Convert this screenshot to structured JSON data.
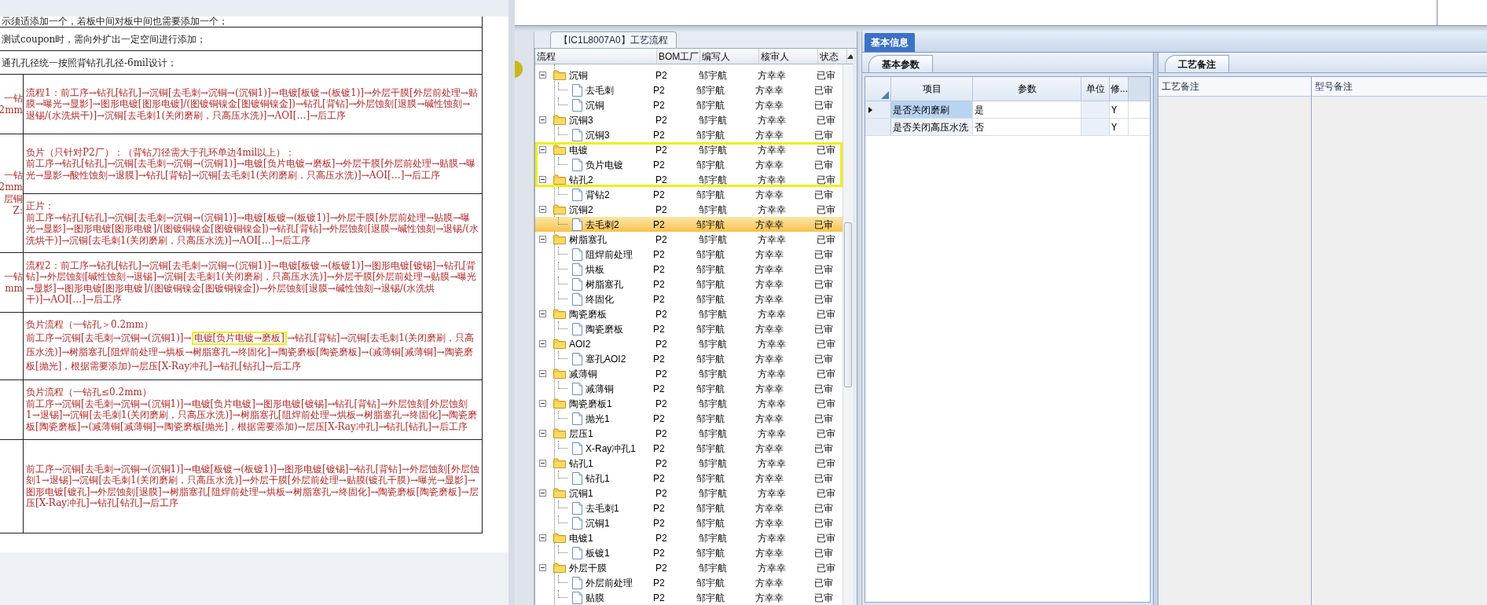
{
  "document": {
    "notes": [
      "示须适添加一个，若板中间对板中间也需要添加一个；",
      "测试coupon时，需向外扩出一定空间进行添加；",
      "通孔孔径统一按照背钻孔孔径-6mil设计；"
    ],
    "rows": [
      {
        "side_label": [
          "一钻",
          "2mm"
        ],
        "cells": [
          [
            "流程1：前工序→钻孔[钻孔]→沉铜[去毛刺→沉铜→(沉铜1)]→电镀[板镀→(板镀1)]→外层干膜[外层前处理→贴膜→曝光→显影]→图形电镀[图形电镀]/(图镀铜镍金[图镀铜镍金])→钻孔[背钻]→外层蚀刻[退膜→碱性蚀刻→退锡/(水洗烘干)]→沉铜[去毛刺1(关闭磨刷，只高压水洗)]→AOI[…]→后工序"
          ]
        ]
      },
      {
        "side_label": [
          "一钻",
          "2mm",
          "层铜",
          "Z:"
        ],
        "cells": [
          [
            "负片（只针对P2厂）：（背钻刀径需大于孔环单边4mil以上）：",
            "前工序→钻孔[钻孔]→沉铜[去毛刺→沉铜→(沉铜1)]→电镀[负片电镀→磨板]→外层干膜[外层前处理→贴膜→曝光→显影→酸性蚀刻→退膜]→钻孔[背钻]→沉铜[去毛刺1(关闭磨刷，只高压水洗)]→AOI[…]→后工序"
          ],
          [
            "正片：",
            "前工序→钻孔[钻孔]→沉铜[去毛刺→沉铜→(沉铜1)]→电镀[板镀→(板镀1)]→外层干膜[外层前处理→贴膜→曝光→显影]→图形电镀[图形电镀]/(图镀铜镍金[图镀铜镍金])→钻孔[背钻]→外层蚀刻[退膜→碱性蚀刻→退锡/(水洗烘干)]→沉铜[去毛刺1(关闭磨刷，只高压水洗)]→AOI[…]→后工序"
          ]
        ]
      },
      {
        "side_label": [
          "一钻",
          "mm"
        ],
        "cells": [
          [
            "流程2：前工序→钻孔[钻孔]→沉铜[去毛刺→沉铜→(沉铜1)]→电镀[板镀→(板镀1)]→图形电镀[镀锡]→钻孔[背钻]→外层蚀刻[碱性蚀刻→退锡]→沉铜[去毛刺1(关闭磨刷，只高压水洗)]→外层干膜[外层前处理→贴膜→曝光→显影]→图形电镀[图形电镀]/(图镀铜镍金[图镀铜镍金])→外层蚀刻[退膜→碱性蚀刻→退锡/(水洗烘干)]→AOI[…]→后工序"
          ]
        ]
      },
      {
        "cells": [
          [
            "负片流程（一钻孔＞0.2mm）",
            {
              "segments": [
                {
                  "text": "前工序→沉铜[去毛刺→沉铜→(沉铜1)]→",
                  "highlighted": false
                },
                {
                  "text": "电镀[负片电镀→磨板]",
                  "highlighted": true
                },
                {
                  "text": "→钻孔[背钻]→沉铜[去毛刺1(关闭磨刷，只高压水洗)]→树脂塞孔[阻焊前处理→烘板→树脂塞孔→终固化]→陶瓷磨板[陶瓷磨板]→(减薄铜[减薄铜]→陶瓷磨板[抛光]，根据需要添加)→层压[X-Ray冲孔]→钻孔[钻孔]→后工序",
                  "highlighted": false
                }
              ]
            }
          ]
        ]
      },
      {
        "cells": [
          [
            "负片流程（一钻孔≤0.2mm）",
            "前工序→沉铜[去毛刺→沉铜→(沉铜1)]→电镀[负片电镀]→图形电镀[镀锡]→钻孔[背钻]→外层蚀刻[外层蚀刻1→退锡]→沉铜[去毛刺1(关闭磨刷，只高压水洗)]→树脂塞孔[阻焊前处理→烘板→树脂塞孔→终固化]→陶瓷磨板[陶瓷磨板]→(减薄铜[减薄铜]→陶瓷磨板[抛光]，根据需要添加)→层压[X-Ray冲孔]→钻孔[钻孔]→后工序"
          ]
        ]
      },
      {
        "cells": [
          [
            "前工序→沉铜[去毛刺→沉铜→(沉铜1)]→电镀[板镀→(板镀1)]→图形电镀[镀锡]→钻孔[背钻]→外层蚀刻[外层蚀刻1→退锡]→沉铜[去毛刺1(关闭磨刷，只高压水洗)]→外层干膜[外层前处理→贴膜(镀孔干膜)→曝光→显影]→图形电镀[镀孔]→外层蚀刻[退膜]→树脂塞孔[阻焊前处理→烘板→树脂塞孔→终固化]→陶瓷磨板[陶瓷磨板]→层压[X-Ray冲孔]→钻孔[钻孔]→后工序"
          ]
        ]
      }
    ]
  },
  "process_panel": {
    "title": "【IC1L8007A0】工艺流程",
    "columns": [
      "流程",
      "BOM工厂",
      "编写人",
      "核审人",
      "状态"
    ],
    "tree": [
      {
        "name": "沉铜",
        "bom_factory": "P2",
        "author": "邹宇航",
        "reviewer": "方幸幸",
        "status": "已审",
        "expanded": true,
        "selected": false,
        "children": [
          {
            "name": "去毛刺",
            "bom_factory": "P2",
            "author": "邹宇航",
            "reviewer": "方幸幸",
            "status": "已审",
            "selected": false
          },
          {
            "name": "沉铜",
            "bom_factory": "P2",
            "author": "邹宇航",
            "reviewer": "方幸幸",
            "status": "已审",
            "selected": false
          }
        ]
      },
      {
        "name": "沉铜3",
        "bom_factory": "P2",
        "author": "邹宇航",
        "reviewer": "方幸幸",
        "status": "已审",
        "expanded": true,
        "selected": false,
        "children": [
          {
            "name": "沉铜3",
            "bom_factory": "P2",
            "author": "邹宇航",
            "reviewer": "方幸幸",
            "status": "已审",
            "selected": false
          }
        ]
      },
      {
        "name": "电镀",
        "bom_factory": "P2",
        "author": "邹宇航",
        "reviewer": "方幸幸",
        "status": "已审",
        "expanded": true,
        "selected": false,
        "highlighted": true,
        "children": [
          {
            "name": "负片电镀",
            "bom_factory": "P2",
            "author": "邹宇航",
            "reviewer": "方幸幸",
            "status": "已审",
            "selected": false,
            "highlighted": true
          }
        ]
      },
      {
        "name": "钻孔2",
        "bom_factory": "P2",
        "author": "邹宇航",
        "reviewer": "方幸幸",
        "status": "已审",
        "expanded": true,
        "selected": false,
        "highlighted": true,
        "children": [
          {
            "name": "背钻2",
            "bom_factory": "P2",
            "author": "邹宇航",
            "reviewer": "方幸幸",
            "status": "已审",
            "selected": false
          }
        ]
      },
      {
        "name": "沉铜2",
        "bom_factory": "P2",
        "author": "邹宇航",
        "reviewer": "方幸幸",
        "status": "已审",
        "expanded": true,
        "selected": false,
        "children": [
          {
            "name": "去毛刺2",
            "bom_factory": "P2",
            "author": "邹宇航",
            "reviewer": "方幸幸",
            "status": "已审",
            "selected": true
          }
        ]
      },
      {
        "name": "树脂塞孔",
        "bom_factory": "P2",
        "author": "邹宇航",
        "reviewer": "方幸幸",
        "status": "已审",
        "expanded": true,
        "selected": false,
        "children": [
          {
            "name": "阻焊前处理",
            "bom_factory": "P2",
            "author": "邹宇航",
            "reviewer": "方幸幸",
            "status": "已审",
            "selected": false
          },
          {
            "name": "烘板",
            "bom_factory": "P2",
            "author": "邹宇航",
            "reviewer": "方幸幸",
            "status": "已审",
            "selected": false
          },
          {
            "name": "树脂塞孔",
            "bom_factory": "P2",
            "author": "邹宇航",
            "reviewer": "方幸幸",
            "status": "已审",
            "selected": false
          },
          {
            "name": "终固化",
            "bom_factory": "P2",
            "author": "邹宇航",
            "reviewer": "方幸幸",
            "status": "已审",
            "selected": false
          }
        ]
      },
      {
        "name": "陶瓷磨板",
        "bom_factory": "P2",
        "author": "邹宇航",
        "reviewer": "方幸幸",
        "status": "已审",
        "expanded": true,
        "selected": false,
        "children": [
          {
            "name": "陶瓷磨板",
            "bom_factory": "P2",
            "author": "邹宇航",
            "reviewer": "方幸幸",
            "status": "已审",
            "selected": false
          }
        ]
      },
      {
        "name": "AOI2",
        "bom_factory": "P2",
        "author": "邹宇航",
        "reviewer": "方幸幸",
        "status": "已审",
        "expanded": true,
        "selected": false,
        "children": [
          {
            "name": "塞孔AOI2",
            "bom_factory": "P2",
            "author": "邹宇航",
            "reviewer": "方幸幸",
            "status": "已审",
            "selected": false
          }
        ]
      },
      {
        "name": "减薄铜",
        "bom_factory": "P2",
        "author": "邹宇航",
        "reviewer": "方幸幸",
        "status": "已审",
        "expanded": true,
        "selected": false,
        "children": [
          {
            "name": "减薄铜",
            "bom_factory": "P2",
            "author": "邹宇航",
            "reviewer": "方幸幸",
            "status": "已审",
            "selected": false
          }
        ]
      },
      {
        "name": "陶瓷磨板1",
        "bom_factory": "P2",
        "author": "邹宇航",
        "reviewer": "方幸幸",
        "status": "已审",
        "expanded": true,
        "selected": false,
        "children": [
          {
            "name": "抛光1",
            "bom_factory": "P2",
            "author": "邹宇航",
            "reviewer": "方幸幸",
            "status": "已审",
            "selected": false
          }
        ]
      },
      {
        "name": "层压1",
        "bom_factory": "P2",
        "author": "邹宇航",
        "reviewer": "方幸幸",
        "status": "已审",
        "expanded": true,
        "selected": false,
        "children": [
          {
            "name": "X-Ray冲孔1",
            "bom_factory": "P2",
            "author": "邹宇航",
            "reviewer": "方幸幸",
            "status": "已审",
            "selected": false
          }
        ]
      },
      {
        "name": "钻孔1",
        "bom_factory": "P2",
        "author": "邹宇航",
        "reviewer": "方幸幸",
        "status": "已审",
        "expanded": true,
        "selected": false,
        "children": [
          {
            "name": "钻孔1",
            "bom_factory": "P2",
            "author": "邹宇航",
            "reviewer": "方幸幸",
            "status": "已审",
            "selected": false
          }
        ]
      },
      {
        "name": "沉铜1",
        "bom_factory": "P2",
        "author": "邹宇航",
        "reviewer": "方幸幸",
        "status": "已审",
        "expanded": true,
        "selected": false,
        "children": [
          {
            "name": "去毛刺1",
            "bom_factory": "P2",
            "author": "邹宇航",
            "reviewer": "方幸幸",
            "status": "已审",
            "selected": false
          },
          {
            "name": "沉铜1",
            "bom_factory": "P2",
            "author": "邹宇航",
            "reviewer": "方幸幸",
            "status": "已审",
            "selected": false
          }
        ]
      },
      {
        "name": "电镀1",
        "bom_factory": "P2",
        "author": "邹宇航",
        "reviewer": "方幸幸",
        "status": "已审",
        "expanded": true,
        "selected": false,
        "children": [
          {
            "name": "板镀1",
            "bom_factory": "P2",
            "author": "邹宇航",
            "reviewer": "方幸幸",
            "status": "已审",
            "selected": false
          }
        ]
      },
      {
        "name": "外层干膜",
        "bom_factory": "P2",
        "author": "邹宇航",
        "reviewer": "方幸幸",
        "status": "已审",
        "expanded": true,
        "selected": false,
        "children": [
          {
            "name": "外层前处理",
            "bom_factory": "P2",
            "author": "邹宇航",
            "reviewer": "方幸幸",
            "status": "已审",
            "selected": false
          },
          {
            "name": "贴膜",
            "bom_factory": "P2",
            "author": "邹宇航",
            "reviewer": "方幸幸",
            "status": "已审",
            "selected": false
          }
        ]
      }
    ]
  },
  "info_panel": {
    "tab": {
      "label": "基本信息",
      "selected": true
    },
    "params": {
      "tab": {
        "label": "基本参数",
        "selected": true
      },
      "columns": [
        "项目",
        "参数",
        "单位",
        "修..."
      ],
      "rows": [
        {
          "item": "是否关闭磨刷",
          "value": "是",
          "column_4": "Y",
          "selected": true
        },
        {
          "item": "是否关闭高压水洗",
          "value": "否",
          "column_4": "Y",
          "selected": false
        }
      ]
    },
    "notes": {
      "tab": {
        "label": "工艺备注",
        "selected": true
      },
      "columns": [
        "工艺备注",
        "型号备注"
      ]
    }
  }
}
